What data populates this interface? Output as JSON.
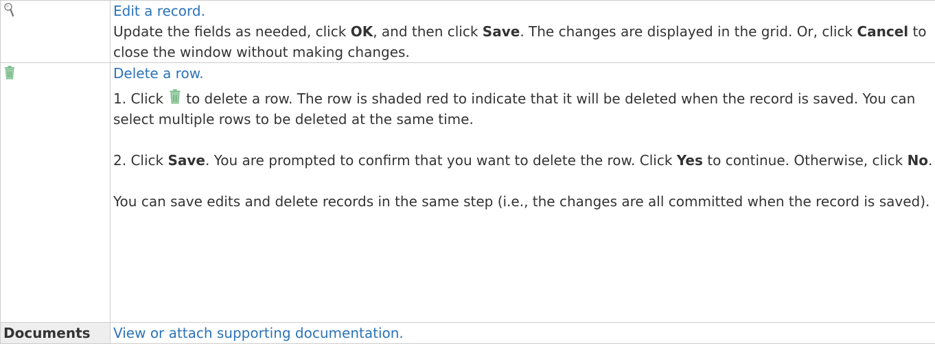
{
  "rows": [
    {
      "icon": "magnifier-icon",
      "link": "Edit a record.",
      "desc": {
        "t1": "Update the fields as needed, click ",
        "b1": "OK",
        "t2": ", and then click ",
        "b2": "Save",
        "t3": ". The changes are displayed in the grid. Or, click ",
        "b3": "Cancel",
        "t4": " to close the window without making changes."
      }
    },
    {
      "icon": "trash-icon",
      "link": "Delete a row.",
      "step1": {
        "t1": "1. Click",
        "icon": "trash-icon",
        "t2": "to delete a row. The row is shaded red to indicate that it will be deleted when the record is saved. You can select multiple rows to be deleted at the same time."
      },
      "step2": {
        "t1": "2. Click ",
        "b1": "Save",
        "t2": ". You are prompted to confirm that you want to delete the row. Click ",
        "b2": "Yes",
        "t3": " to continue. Otherwise, click ",
        "b3": "No",
        "t4": "."
      },
      "note": "You can save edits and delete records in the same step (i.e., the changes are all committed when the record is saved)."
    },
    {
      "label": "Documents",
      "link": "View or attach supporting documentation."
    }
  ],
  "colors": {
    "link": "#2b73b7",
    "text": "#333333",
    "border": "#cccccc",
    "label_bg": "#eeeeee",
    "icon_green": "#7fbf8f"
  }
}
